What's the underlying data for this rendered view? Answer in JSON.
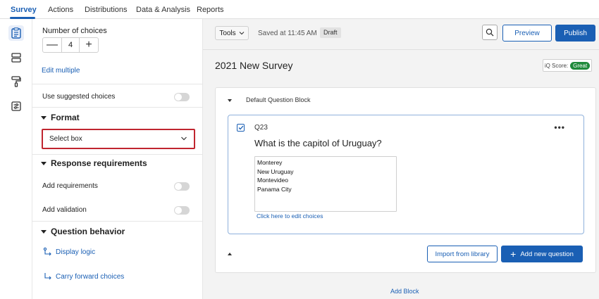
{
  "nav": {
    "tabs": [
      {
        "label": "Survey"
      },
      {
        "label": "Actions"
      },
      {
        "label": "Distributions"
      },
      {
        "label": "Data & Analysis"
      },
      {
        "label": "Reports"
      }
    ],
    "active_tab": "Survey"
  },
  "rail": {
    "icons": [
      "survey-flow-clipboard-icon",
      "blocks-icon",
      "paint-roller-icon",
      "survey-options-icon"
    ]
  },
  "panel": {
    "number_of_choices_label": "Number of choices",
    "choices_count": "4",
    "minus": "—",
    "plus": "+",
    "edit_multiple": "Edit multiple",
    "use_suggested_choices": "Use suggested choices",
    "format_section": "Format",
    "format_select_value": "Select box",
    "response_requirements_section": "Response requirements",
    "add_requirements": "Add requirements",
    "add_validation": "Add validation",
    "question_behavior_section": "Question behavior",
    "display_logic": "Display logic",
    "carry_forward_choices": "Carry forward choices"
  },
  "toolbar": {
    "tools_label": "Tools",
    "saved_status": "Saved at 11:45 AM",
    "draft_badge": "Draft",
    "preview_label": "Preview",
    "publish_label": "Publish"
  },
  "survey": {
    "title": "2021 New Survey",
    "iq_score_label": "iQ Score:",
    "iq_score_value": "Great",
    "block_name": "Default Question Block",
    "question": {
      "number": "Q23",
      "text": "What is the capitol of Uruguay?",
      "choices": [
        "Monterey",
        "New Uruguay",
        "Montevideo",
        "Panama City"
      ],
      "edit_choices_link": "Click here to edit choices"
    },
    "import_from_library": "Import from library",
    "add_new_question": "Add new question",
    "add_block": "Add Block"
  },
  "colors": {
    "accent": "#1a5fb4",
    "highlight_border": "#c0252f",
    "iq_great": "#1f8a3b"
  }
}
